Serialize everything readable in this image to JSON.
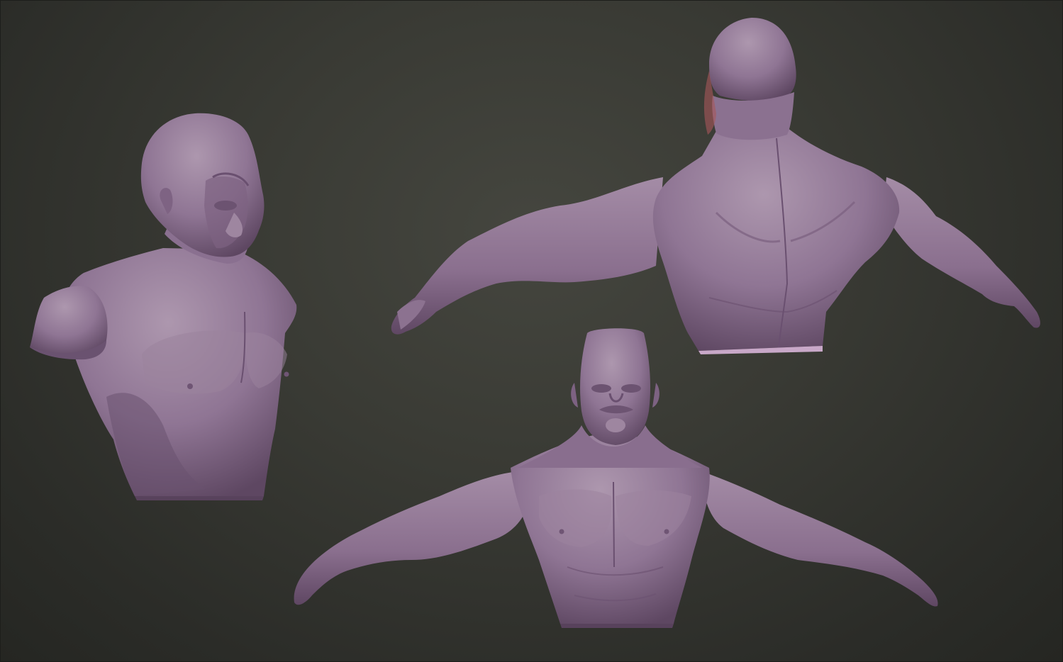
{
  "scene": {
    "background_top": "#45463f",
    "background_bottom": "#252622",
    "clay_color": "#8f7594",
    "clay_light": "#a891aa",
    "clay_shadow": "#5c4560",
    "clay_rim": "#c06a6a"
  },
  "views": [
    {
      "name": "three-quarter-bust"
    },
    {
      "name": "back-view-arms-out"
    },
    {
      "name": "front-view-arms-out"
    }
  ]
}
